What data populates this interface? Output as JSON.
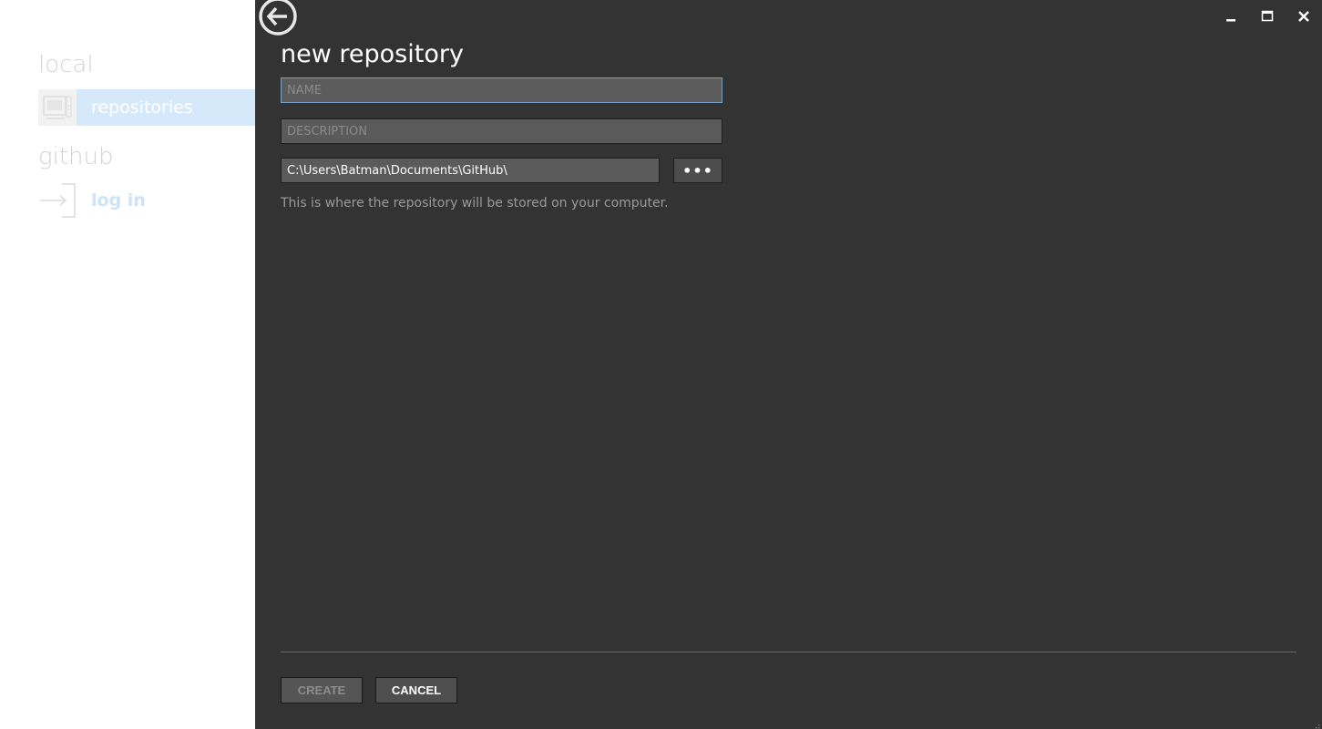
{
  "sidebar": {
    "local_heading": "local",
    "github_heading": "github",
    "items": [
      {
        "label": "repositories",
        "icon": "computer-icon",
        "selected": true
      },
      {
        "label": "log in",
        "icon": "login-icon",
        "selected": false
      }
    ]
  },
  "window": {
    "controls": [
      "minimize",
      "maximize",
      "close"
    ]
  },
  "form": {
    "title": "new repository",
    "name_placeholder": "NAME",
    "name_value": "",
    "description_placeholder": "DESCRIPTION",
    "description_value": "",
    "path_value": "C:\\Users\\Batman\\Documents\\GitHub\\",
    "browse_label": "•••",
    "hint": "This is where the repository will be stored on your computer."
  },
  "actions": {
    "create_label": "CREATE",
    "create_enabled": false,
    "cancel_label": "CANCEL"
  },
  "colors": {
    "main_bg": "#333333",
    "sidebar_bg": "#ffffff",
    "selection_bg": "#d6e9fb",
    "focus_border": "#7a9fc6"
  }
}
